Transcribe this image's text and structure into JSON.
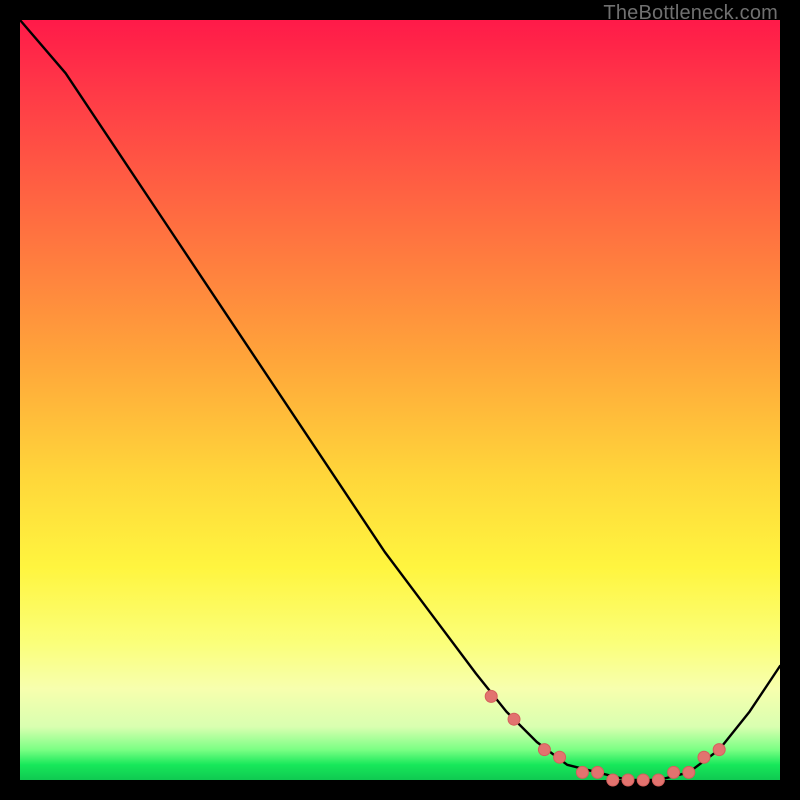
{
  "watermark": "TheBottleneck.com",
  "colors": {
    "frame": "#000000",
    "curve_stroke": "#000000",
    "marker_fill": "#e2736f",
    "marker_stroke": "#d4605c"
  },
  "chart_data": {
    "type": "line",
    "title": "",
    "xlabel": "",
    "ylabel": "",
    "xlim": [
      0,
      100
    ],
    "ylim": [
      0,
      100
    ],
    "grid": false,
    "legend": false,
    "series": [
      {
        "name": "bottleneck-curve",
        "x": [
          0,
          6,
          12,
          18,
          24,
          30,
          36,
          42,
          48,
          54,
          60,
          64,
          68,
          72,
          76,
          80,
          84,
          88,
          92,
          96,
          100
        ],
        "y": [
          100,
          93,
          84,
          75,
          66,
          57,
          48,
          39,
          30,
          22,
          14,
          9,
          5,
          2,
          1,
          0,
          0,
          1,
          4,
          9,
          15
        ]
      }
    ],
    "markers": {
      "name": "trough-markers",
      "x": [
        62,
        65,
        69,
        71,
        74,
        76,
        78,
        80,
        82,
        84,
        86,
        88,
        90,
        92
      ],
      "y": [
        11,
        8,
        4,
        3,
        1,
        1,
        0,
        0,
        0,
        0,
        1,
        1,
        3,
        4
      ]
    }
  }
}
